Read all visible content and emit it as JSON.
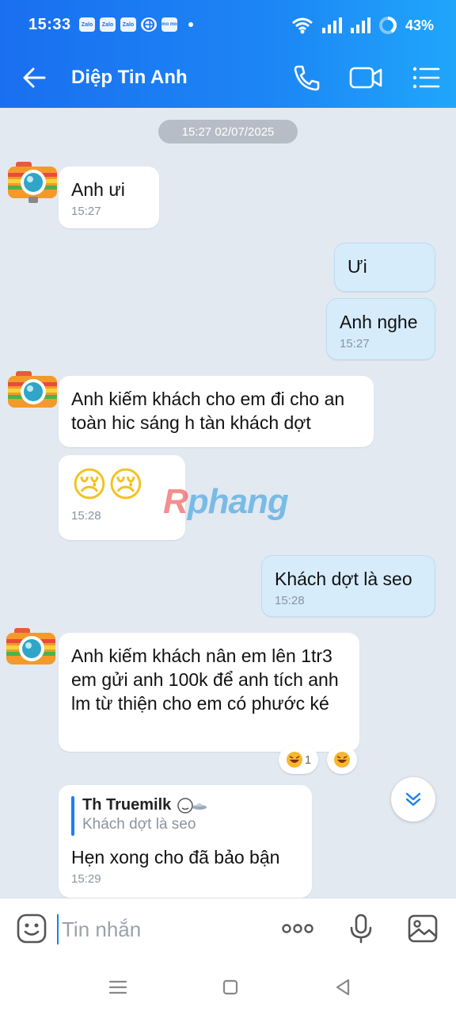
{
  "status": {
    "time": "15:33",
    "apps": [
      "Zalo",
      "Zalo",
      "Zalo",
      "",
      "mo mo"
    ],
    "battery": "43%"
  },
  "header": {
    "contact_name": "Diệp Tin Anh",
    "accent": "#1a7ff0"
  },
  "chat": {
    "date_separator": "15:27 02/07/2025",
    "messages": [
      {
        "text": "Anh ưi",
        "time": "15:27"
      },
      {
        "text": "Ưi",
        "time": ""
      },
      {
        "text": "Anh nghe",
        "time": "15:27"
      },
      {
        "text": "Anh kiếm khách cho em đi cho an toàn hic sáng h tàn khách dợt",
        "time": ""
      },
      {
        "emoji": "😢😢",
        "time": "15:28"
      },
      {
        "text": "Khách dợt là seo",
        "time": "15:28"
      },
      {
        "text": "Anh kiếm khách nân em lên 1tr3 em gửi anh 100k để anh tích anh lm từ thiện cho em có phước ké",
        "time": "",
        "reaction_count": "1"
      },
      {
        "quote_name": "Th Truemilk",
        "quote_text": "Khách dợt là seo",
        "text": "Hẹn xong cho đã bảo bận",
        "time": "15:29"
      }
    ],
    "watermark": {
      "part1": "R",
      "part2": "phang"
    }
  },
  "composer": {
    "placeholder": "Tin nhắn"
  }
}
